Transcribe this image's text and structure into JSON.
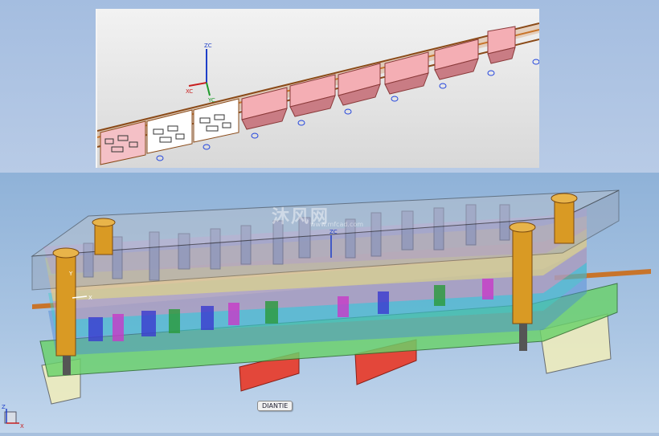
{
  "top_view": {
    "axes": {
      "z": "ZC",
      "x": "XC",
      "y": "YC"
    }
  },
  "assembly_view": {
    "axes": {
      "z": "ZC",
      "x": "X",
      "y": "Y"
    },
    "corner_triad": {
      "z": "Z",
      "x": "X"
    },
    "strip_tag": "DIANTIE",
    "watermark": {
      "text": "沐风网",
      "url": "www.mfcad.com"
    }
  },
  "colors": {
    "strip": "#c8742a",
    "part": "#f4aeb4",
    "die_bottom": "#6ad26a",
    "die_top": "#9aa5b8",
    "guide_post": "#d99a24",
    "support": "#e3473a"
  }
}
